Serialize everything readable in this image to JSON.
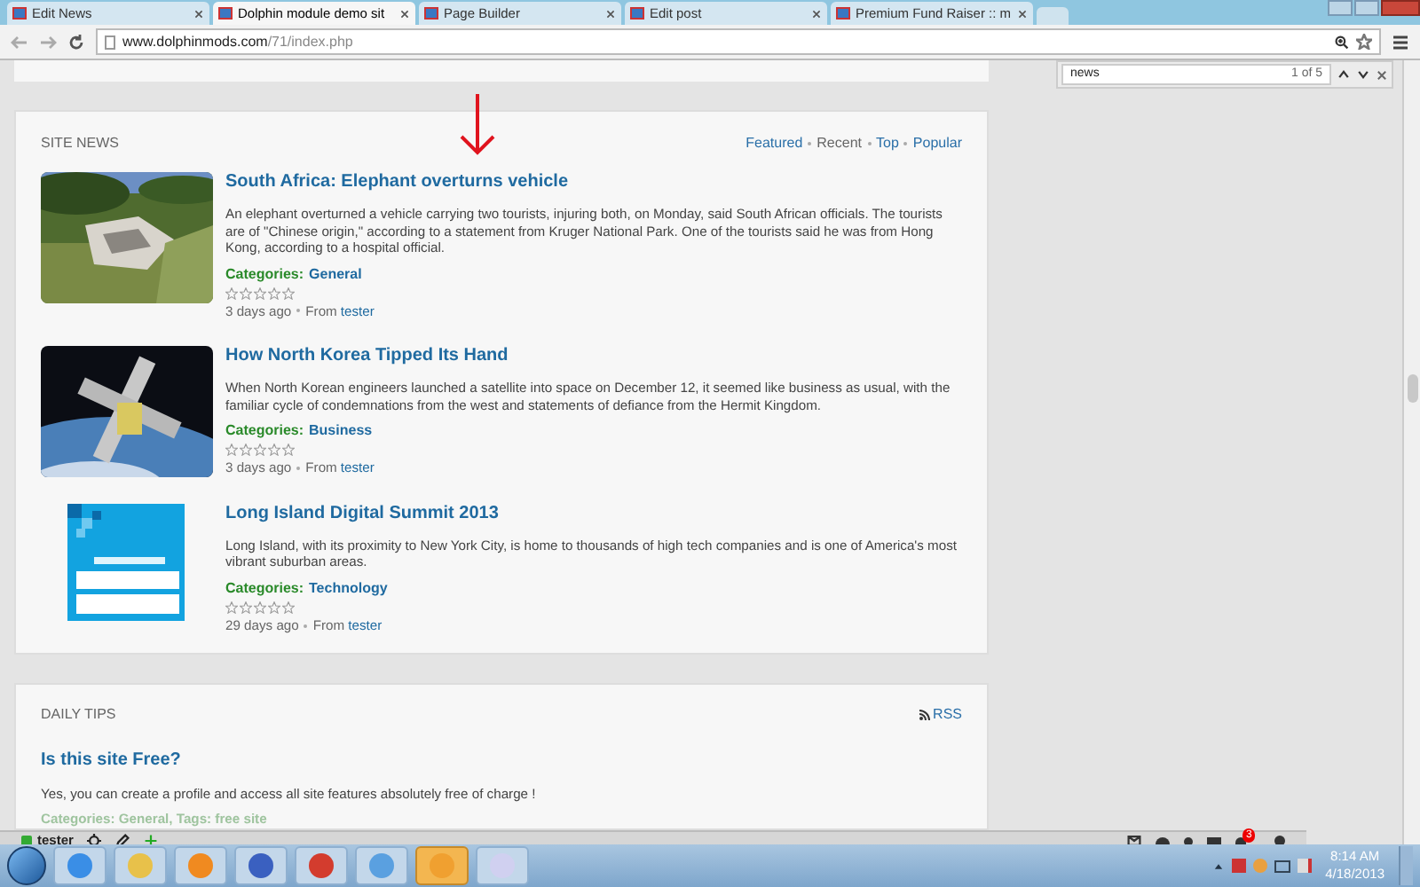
{
  "browser": {
    "tabs": [
      {
        "label": "Edit News",
        "selected": false
      },
      {
        "label": "Dolphin module demo sit",
        "selected": true
      },
      {
        "label": "Page Builder",
        "selected": false
      },
      {
        "label": "Edit post",
        "selected": false
      },
      {
        "label": "Premium Fund Raiser :: m",
        "selected": false
      }
    ],
    "address": {
      "host": "www.dolphinmods.com",
      "path": "/71/index.php"
    },
    "find": {
      "value": "news",
      "count": "1 of 5"
    }
  },
  "site_news": {
    "title": "SITE NEWS",
    "filters": [
      {
        "label": "Featured",
        "selected": false
      },
      {
        "label": "Recent",
        "selected": true
      },
      {
        "label": "Top",
        "selected": false
      },
      {
        "label": "Popular",
        "selected": false
      }
    ],
    "items": [
      {
        "title": "South Africa: Elephant overturns vehicle",
        "text": "An elephant overturned a vehicle carrying two tourists, injuring both, on Monday, said South African officials. The tourists are of \"Chinese origin,\" according to a statement from Kruger National Park. One of the tourists said he was from Hong Kong, according to a hospital official.",
        "category_label": "Categories:",
        "category": "General",
        "stars": 0,
        "age": "3 days ago",
        "from": "From",
        "author": "tester"
      },
      {
        "title": "How North Korea Tipped Its Hand",
        "text": "When North Korean engineers launched a satellite into space on December 12, it seemed like business as usual, with the familiar cycle of condemnations from the west and statements of defiance from the Hermit Kingdom.",
        "category_label": "Categories:",
        "category": "Business",
        "stars": 0,
        "age": "3 days ago",
        "from": "From",
        "author": "tester"
      },
      {
        "title": "Long Island Digital Summit 2013",
        "text": "Long Island, with its proximity to New York City, is home to thousands of high tech companies and is one of America's most vibrant suburban areas.",
        "category_label": "Categories:",
        "category": "Technology",
        "stars": 0,
        "age": "29 days ago",
        "from": "From",
        "author": "tester"
      }
    ]
  },
  "daily_tips": {
    "title": "DAILY TIPS",
    "rss": "RSS",
    "question": "Is this site Free?",
    "answer": "Yes, you can create a profile and access all site features absolutely free of charge !",
    "meta": "Categories: General, Tags: free site"
  },
  "member_bar": {
    "user": "tester",
    "notifications": "3"
  },
  "taskbar": {
    "time": "8:14 AM",
    "date": "4/18/2013"
  }
}
